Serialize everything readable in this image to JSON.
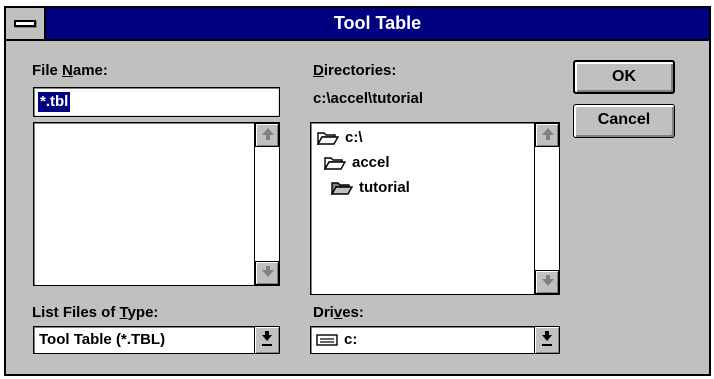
{
  "window": {
    "title": "Tool Table"
  },
  "file_name": {
    "label_prefix": "File ",
    "label_accel": "N",
    "label_suffix": "ame:",
    "value": "*.tbl",
    "files": []
  },
  "directories": {
    "label_accel": "D",
    "label_suffix": "irectories:",
    "current_path": "c:\\accel\\tutorial",
    "items": [
      {
        "name": "c:\\",
        "icon": "open-folder-icon"
      },
      {
        "name": "accel",
        "icon": "open-folder-icon"
      },
      {
        "name": "tutorial",
        "icon": "open-folder-selected-icon"
      }
    ]
  },
  "file_type": {
    "label_prefix": "List Files of ",
    "label_accel": "T",
    "label_suffix": "ype:",
    "value": "Tool Table (*.TBL)"
  },
  "drives": {
    "label_prefix": "Dri",
    "label_accel": "v",
    "label_suffix": "es:",
    "value": "c:",
    "icon": "hard-drive-icon"
  },
  "buttons": {
    "ok": "OK",
    "cancel": "Cancel"
  },
  "colors": {
    "titlebar": "#000080",
    "face": "#c0c0c0",
    "selection": "#000080"
  }
}
